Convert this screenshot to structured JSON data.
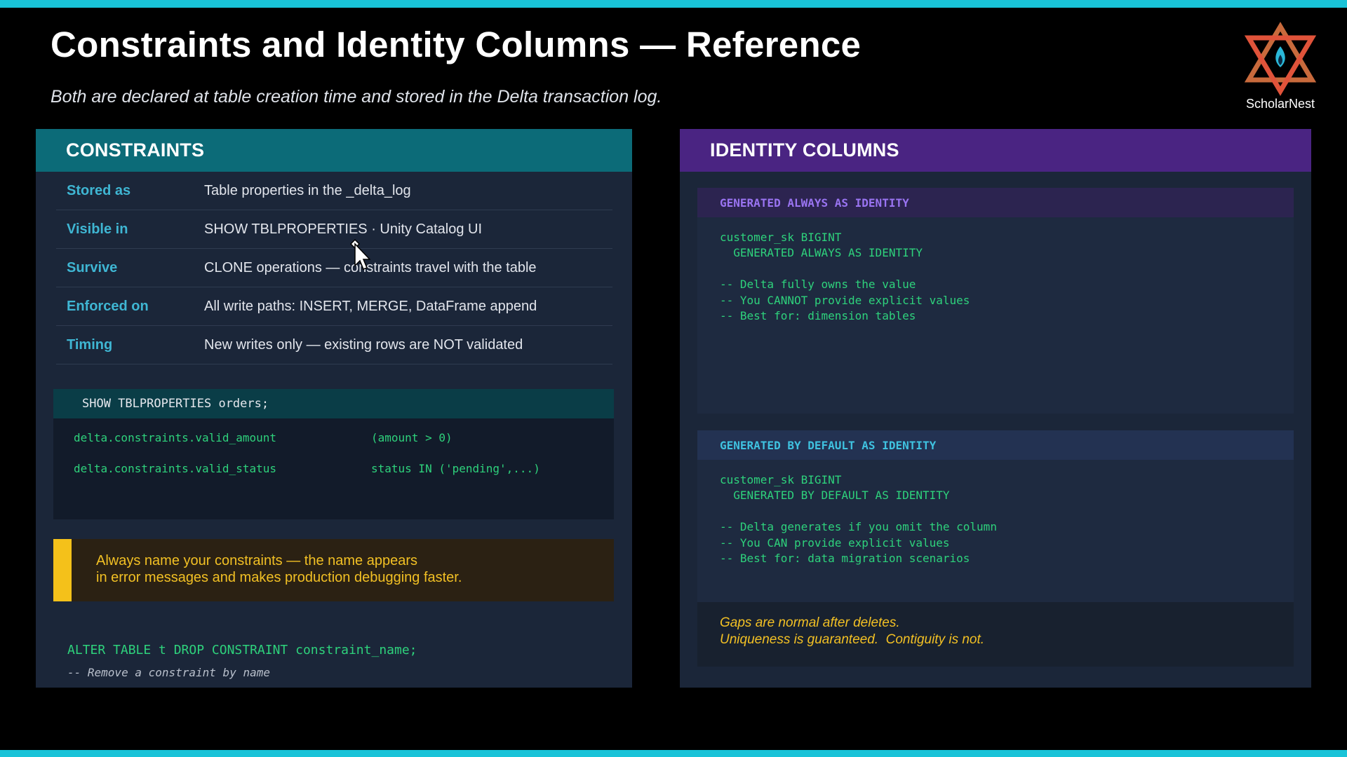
{
  "slide": {
    "title": "Constraints and Identity Columns — Reference",
    "subtitle": "Both are declared at table creation time and stored in the Delta transaction log."
  },
  "logo": {
    "name": "ScholarNest",
    "icon": "star-of-david-flame-logo"
  },
  "constraints": {
    "heading": "CONSTRAINTS",
    "rows": [
      {
        "label": "Stored as",
        "value": "Table properties in the _delta_log"
      },
      {
        "label": "Visible in",
        "value": "SHOW TBLPROPERTIES  ·  Unity Catalog UI"
      },
      {
        "label": "Survive",
        "value": "CLONE operations — constraints travel with the table"
      },
      {
        "label": "Enforced on",
        "value": "All write paths: INSERT, MERGE, DataFrame append"
      },
      {
        "label": "Timing",
        "value": "New writes only — existing rows are NOT validated"
      }
    ],
    "code": {
      "header": "SHOW TBLPROPERTIES orders;",
      "lines": [
        {
          "key": "delta.constraints.valid_amount",
          "value": "(amount > 0)"
        },
        {
          "key": "delta.constraints.valid_status",
          "value": "status IN ('pending',...)"
        }
      ]
    },
    "note": {
      "line1": "Always name your constraints — the name appears",
      "line2": "in error messages and makes production debugging faster."
    },
    "alter": "ALTER TABLE t DROP CONSTRAINT constraint_name;",
    "alter_comment": "-- Remove a constraint by name"
  },
  "identity": {
    "heading": "IDENTITY COLUMNS",
    "always": {
      "header": "GENERATED ALWAYS AS IDENTITY",
      "code": "customer_sk BIGINT\n  GENERATED ALWAYS AS IDENTITY\n\n-- Delta fully owns the value\n-- You CANNOT provide explicit values\n-- Best for: dimension tables"
    },
    "by_default": {
      "header": "GENERATED BY DEFAULT AS IDENTITY",
      "code": "customer_sk BIGINT\n  GENERATED BY DEFAULT AS IDENTITY\n\n-- Delta generates if you omit the column\n-- You CAN provide explicit values\n-- Best for: data migration scenarios"
    },
    "footnote": "Gaps are normal after deletes.\nUniqueness is guaranteed.  Contiguity is not."
  },
  "colors": {
    "accent_bar": "#19c3d8",
    "constraints_header": "#0c6b78",
    "identity_header": "#4a2482",
    "code_green": "#2ed27c",
    "note_yellow": "#f2c024"
  }
}
